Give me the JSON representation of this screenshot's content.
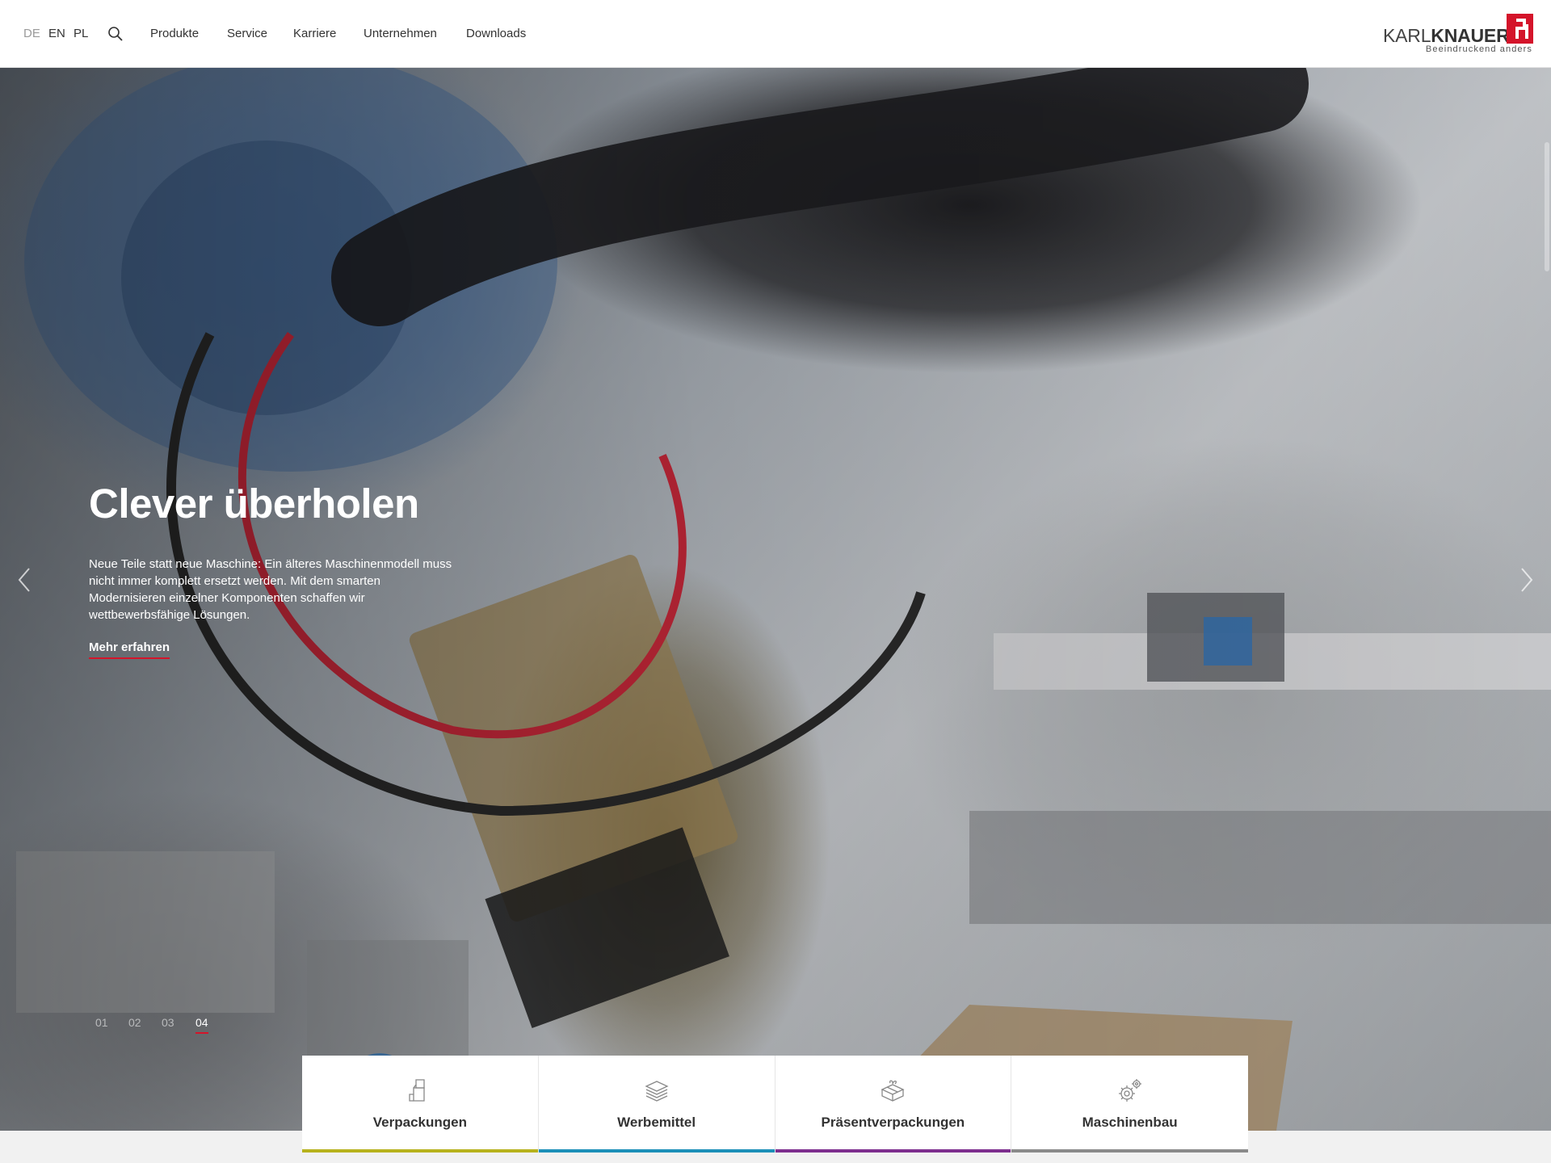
{
  "header": {
    "languages": [
      {
        "code": "DE",
        "active": true
      },
      {
        "code": "EN",
        "active": false
      },
      {
        "code": "PL",
        "active": false
      }
    ],
    "nav": [
      "Produkte",
      "Service",
      "Karriere",
      "Unternehmen",
      "Downloads"
    ],
    "logo": {
      "part1": "KARL",
      "part2": "KNAUER",
      "tagline": "Beeindruckend anders",
      "brand_color": "#d4142a"
    },
    "icons": {
      "search": "search-icon"
    }
  },
  "hero": {
    "title": "Clever überholen",
    "text": "Neue Teile statt neue Maschine: Ein älteres Maschinenmodell muss nicht immer komplett ersetzt werden. Mit dem smarten Modernisieren einzelner Komponenten schaffen wir wettbewerbsfähige Lösungen.",
    "link": "Mehr erfahren",
    "slides": [
      "01",
      "02",
      "03",
      "04"
    ],
    "active_slide": "04",
    "icons": {
      "prev": "chevron-left-icon",
      "next": "chevron-right-icon",
      "scroll": "arrow-down-icon"
    }
  },
  "categories": [
    {
      "label": "Verpackungen",
      "icon": "folding-box-icon",
      "color": "#b7b21d"
    },
    {
      "label": "Werbemittel",
      "icon": "layers-stack-icon",
      "color": "#1c8fb8"
    },
    {
      "label": "Präsentverpackungen",
      "icon": "gift-box-icon",
      "color": "#7d2e8e"
    },
    {
      "label": "Maschinenbau",
      "icon": "gears-icon",
      "color": "#8a8a8a"
    }
  ]
}
